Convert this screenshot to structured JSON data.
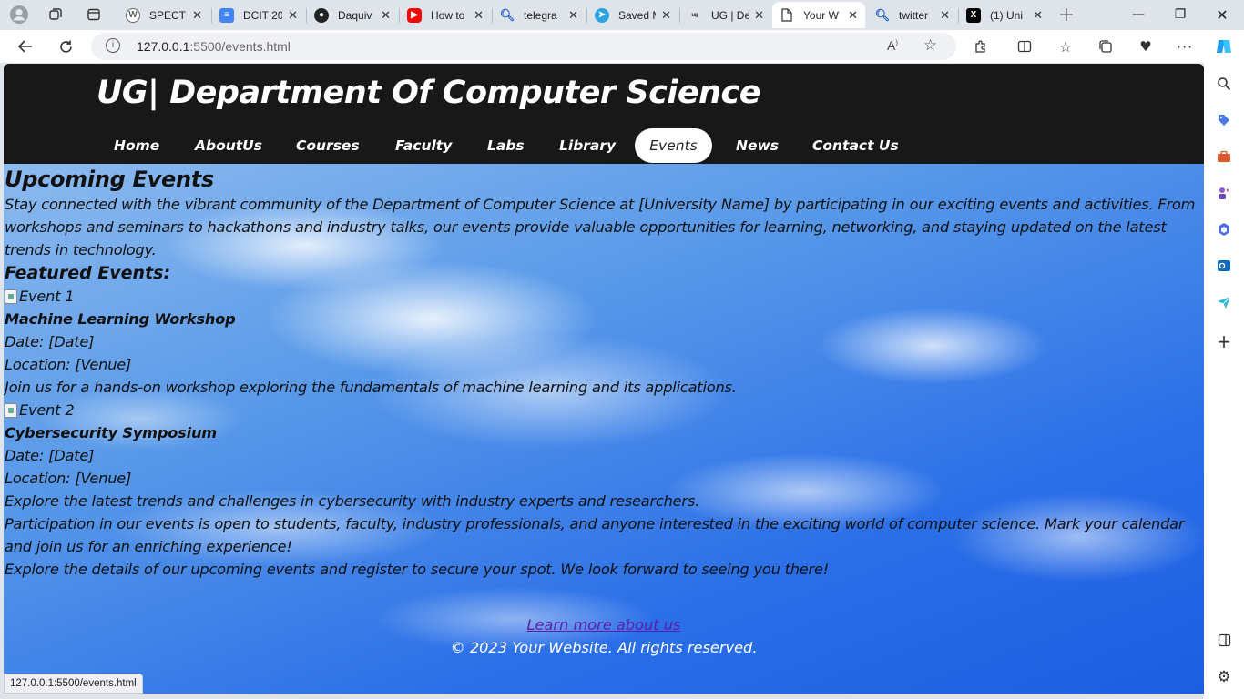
{
  "browser": {
    "tabs": [
      {
        "title": "SPECTR",
        "icon": "wordpress-icon"
      },
      {
        "title": "DCIT 20",
        "icon": "google-docs-icon"
      },
      {
        "title": "Daquiv",
        "icon": "github-icon"
      },
      {
        "title": "How to",
        "icon": "youtube-icon"
      },
      {
        "title": "telegra",
        "icon": "search-icon"
      },
      {
        "title": "Saved M",
        "icon": "telegram-icon"
      },
      {
        "title": "UG | De",
        "icon": "site-icon"
      },
      {
        "title": "Your W",
        "icon": "page-icon"
      },
      {
        "title": "twitter",
        "icon": "search-icon"
      },
      {
        "title": "(1) Uni",
        "icon": "x-icon"
      }
    ],
    "url_host": "127.0.0.1",
    "url_rest": ":5500/events.html",
    "status_url": "127.0.0.1:5500/events.html"
  },
  "site": {
    "title": "UG| Department Of Computer Science",
    "nav": [
      "Home",
      "AboutUs",
      "Courses",
      "Faculty",
      "Labs",
      "Library",
      "Events",
      "News",
      "Contact Us"
    ],
    "active_nav": "Events"
  },
  "content": {
    "heading": "Upcoming Events",
    "intro": "Stay connected with the vibrant community of the Department of Computer Science at [University Name] by participating in our exciting events and activities. From workshops and seminars to hackathons and industry talks, our events provide valuable opportunities for learning, networking, and staying updated on the latest trends in technology.",
    "featured_heading": "Featured Events:",
    "events": [
      {
        "img_alt": "Event 1",
        "title": "Machine Learning Workshop",
        "date": "Date: [Date]",
        "location": "Location: [Venue]",
        "description": "Join us for a hands-on workshop exploring the fundamentals of machine learning and its applications."
      },
      {
        "img_alt": "Event 2",
        "title": "Cybersecurity Symposium",
        "date": "Date: [Date]",
        "location": "Location: [Venue]",
        "description": "Explore the latest trends and challenges in cybersecurity with industry experts and researchers."
      }
    ],
    "participation": "Participation in our events is open to students, faculty, industry professionals, and anyone interested in the exciting world of computer science. Mark your calendar and join us for an enriching experience!",
    "closing": "Explore the details of our upcoming events and register to secure your spot. We look forward to seeing you there!"
  },
  "footer": {
    "link": "Learn more about us",
    "copyright": "© 2023 Your Website. All rights reserved."
  },
  "colors": {
    "header_bg": "#181818",
    "link": "#5a1fa8",
    "sky": "#2a6ee8"
  }
}
